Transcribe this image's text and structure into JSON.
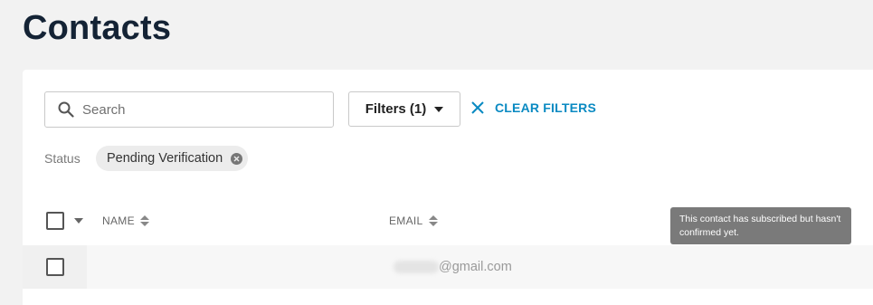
{
  "page": {
    "title": "Contacts"
  },
  "toolbar": {
    "search_placeholder": "Search",
    "filters_label": "Filters (1)",
    "clear_filters_label": "CLEAR FILTERS"
  },
  "active_filters": {
    "status_label": "Status",
    "chips": [
      "Pending Verification"
    ]
  },
  "table": {
    "columns": [
      "NAME",
      "EMAIL"
    ],
    "rows": [
      {
        "name": "",
        "email_domain": "@gmail.com"
      }
    ]
  },
  "tooltip": {
    "text": "This contact has subscribed but hasn't confirmed yet."
  },
  "colors": {
    "accent": "#0a8ac2",
    "title": "#142335",
    "background": "#f2f2f2",
    "tooltip_bg": "#7a7a7a"
  }
}
